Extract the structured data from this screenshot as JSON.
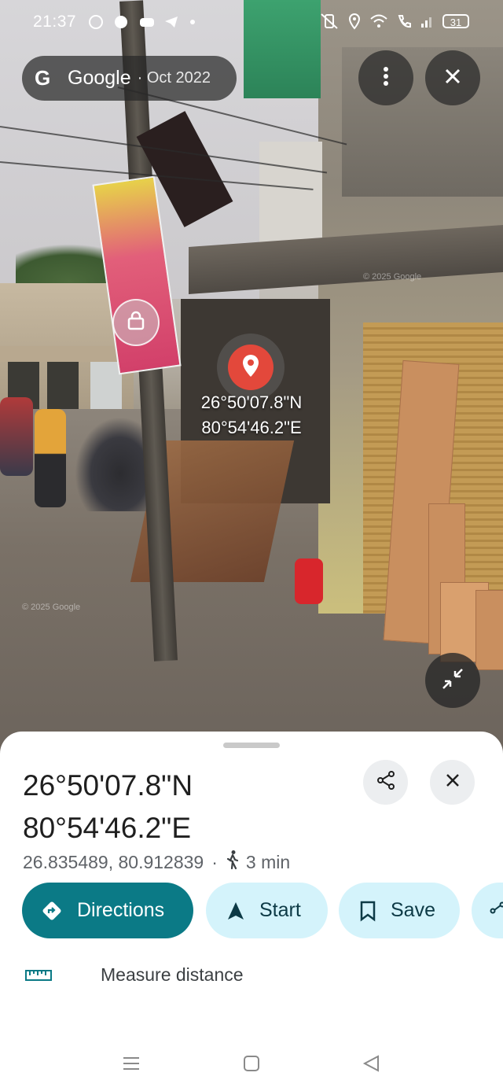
{
  "status_bar": {
    "time": "21:37",
    "battery": "31"
  },
  "streetview": {
    "brand": "Google",
    "date": "· Oct 2022",
    "pin_coords": [
      "26°50'07.8\"N",
      "80°54'46.2\"E"
    ],
    "watermark": "© 2025 Google",
    "icons": {
      "more": "more-vert-icon",
      "close": "close-icon",
      "bag": "shopping-bag-icon",
      "pin": "location-pin-icon",
      "collapse": "collapse-icon"
    }
  },
  "place": {
    "title_line1": "26°50'07.8\"N",
    "title_line2": "80°54'46.2\"E",
    "decimal_coords": "26.835489, 80.912839",
    "separator": "·",
    "walk_time": "3 min"
  },
  "actions": [
    {
      "label": "Directions",
      "icon": "directions-icon",
      "style": "primary"
    },
    {
      "label": "Start",
      "icon": "navigation-arrow-icon",
      "style": "secondary"
    },
    {
      "label": "Save",
      "icon": "bookmark-icon",
      "style": "secondary"
    }
  ],
  "measure": {
    "label": "Measure distance",
    "icon": "ruler-icon"
  },
  "colors": {
    "primary_chip": "#0b7a86",
    "secondary_chip": "#d4f3fb",
    "pin_red": "#e3483b"
  }
}
